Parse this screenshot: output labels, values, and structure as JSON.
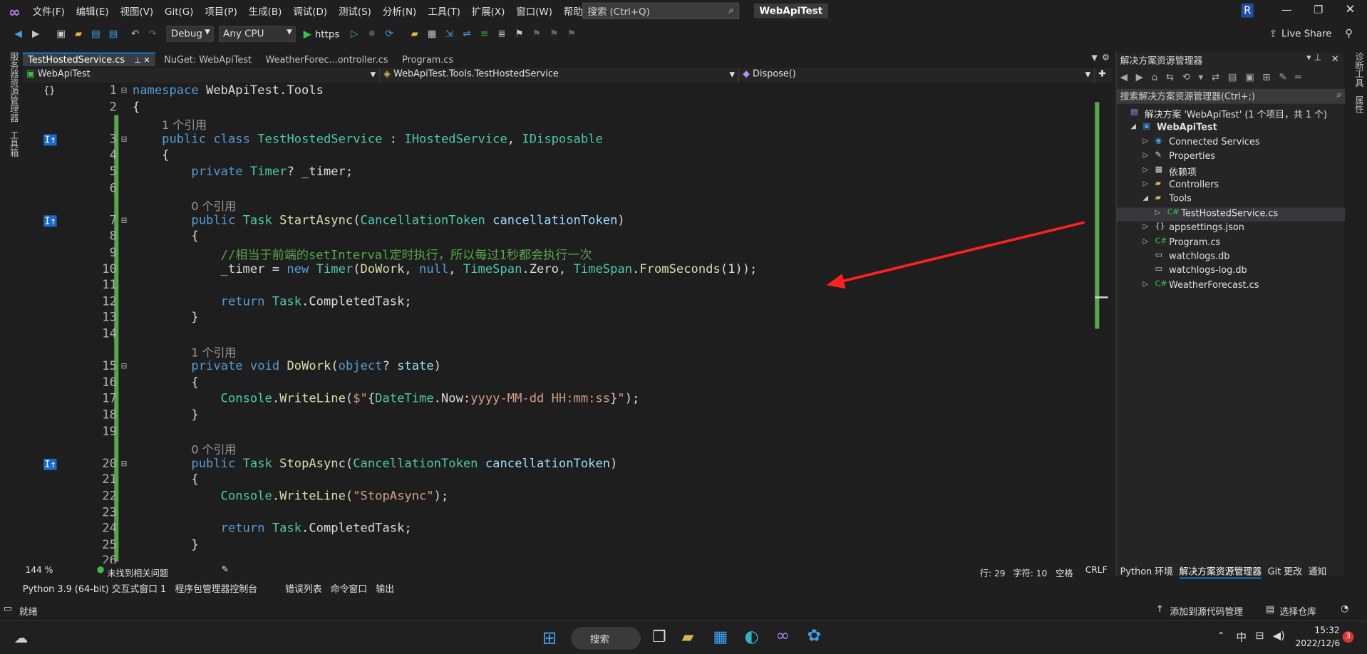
{
  "titlebar": {
    "menus": [
      "文件(F)",
      "编辑(E)",
      "视图(V)",
      "Git(G)",
      "项目(P)",
      "生成(B)",
      "调试(D)",
      "测试(S)",
      "分析(N)",
      "工具(T)",
      "扩展(X)",
      "窗口(W)",
      "帮助(H)"
    ],
    "search_placeholder": "搜索 (Ctrl+Q)",
    "app_title": "WebApiTest",
    "avatar": "R"
  },
  "toolbar": {
    "config": "Debug",
    "platform": "Any CPU",
    "run": "https",
    "live_share": "Live Share"
  },
  "tabs": [
    "TestHostedService.cs",
    "NuGet: WebApiTest",
    "WeatherForec...ontroller.cs",
    "Program.cs"
  ],
  "navbar": {
    "project": "WebApiTest",
    "type": "WebApiTest.Tools.TestHostedService",
    "member": "Dispose()"
  },
  "left_strip": [
    "服务器资源管理器",
    "工具箱"
  ],
  "right_strip": [
    "诊断工具",
    "属性"
  ],
  "code_lines": [
    {
      "n": "1",
      "html": "<span class='kw'>namespace</span> WebApiTest.Tools"
    },
    {
      "n": "2",
      "html": "{"
    },
    {
      "n": "",
      "html": "    <span class='ref'>1 个引用</span>"
    },
    {
      "n": "3",
      "html": "    <span class='kw'>public</span> <span class='kw'>class</span> <span class='ty'>TestHostedService</span> : <span class='ty'>IHostedService</span>, <span class='ty'>IDisposable</span>"
    },
    {
      "n": "4",
      "html": "    {"
    },
    {
      "n": "5",
      "html": "        <span class='kw'>private</span> <span class='ty'>Timer</span>? _timer;"
    },
    {
      "n": "6",
      "html": ""
    },
    {
      "n": "",
      "html": "        <span class='ref'>0 个引用</span>"
    },
    {
      "n": "7",
      "html": "        <span class='kw'>public</span> <span class='ty'>Task</span> <span class='fn'>StartAsync</span>(<span class='ty'>CancellationToken</span> <span class='pm'>cancellationToken</span>)"
    },
    {
      "n": "8",
      "html": "        {"
    },
    {
      "n": "9",
      "html": "            <span class='cm'>//相当于前端的setInterval定时执行，所以每过1秒都会执行一次</span>"
    },
    {
      "n": "10",
      "html": "            _timer = <span class='kw'>new</span> <span class='ty'>Timer</span>(<span class='fn'>DoWork</span>, <span class='kw'>null</span>, <span class='ty'>TimeSpan</span>.Zero, <span class='ty'>TimeSpan</span>.<span class='fn'>FromSeconds</span>(1));"
    },
    {
      "n": "11",
      "html": ""
    },
    {
      "n": "12",
      "html": "            <span class='kw'>return</span> <span class='ty'>Task</span>.CompletedTask;"
    },
    {
      "n": "13",
      "html": "        }"
    },
    {
      "n": "14",
      "html": ""
    },
    {
      "n": "",
      "html": "        <span class='ref'>1 个引用</span>"
    },
    {
      "n": "15",
      "html": "        <span class='kw'>private</span> <span class='kw'>void</span> <span class='fn'>DoWork</span>(<span class='kw'>object</span>? <span class='pm'>state</span>)"
    },
    {
      "n": "16",
      "html": "        {"
    },
    {
      "n": "17",
      "html": "            <span class='ty'>Console</span>.<span class='fn'>WriteLine</span>(<span class='st'>$\"</span>{<span class='ty'>DateTime</span>.Now:<span class='st'>yyyy-MM-dd HH:mm:ss</span>}<span class='st'>\"</span>);"
    },
    {
      "n": "18",
      "html": "        }"
    },
    {
      "n": "19",
      "html": ""
    },
    {
      "n": "",
      "html": "        <span class='ref'>0 个引用</span>"
    },
    {
      "n": "20",
      "html": "        <span class='kw'>public</span> <span class='ty'>Task</span> <span class='fn'>StopAsync</span>(<span class='ty'>CancellationToken</span> <span class='pm'>cancellationToken</span>)"
    },
    {
      "n": "21",
      "html": "        {"
    },
    {
      "n": "22",
      "html": "            <span class='ty'>Console</span>.<span class='fn'>WriteLine</span>(<span class='st'>\"StopAsync\"</span>);"
    },
    {
      "n": "23",
      "html": ""
    },
    {
      "n": "24",
      "html": "            <span class='kw'>return</span> <span class='ty'>Task</span>.CompletedTask;"
    },
    {
      "n": "25",
      "html": "        }"
    },
    {
      "n": "26",
      "html": ""
    }
  ],
  "editor_status": {
    "zoom": "144 %",
    "issues": "未找到相关问题",
    "line": "行: 29",
    "col": "字符: 10",
    "ws": "空格",
    "eol": "CRLF"
  },
  "solution_explorer": {
    "title": "解决方案资源管理器",
    "search": "搜索解决方案资源管理器(Ctrl+;)",
    "items": [
      {
        "label": "解决方案 'WebApiTest' (1 个项目，共 1 个)",
        "icon": "solution-icon",
        "indent": 0
      },
      {
        "label": "WebApiTest",
        "icon": "project-icon",
        "indent": 1,
        "bold": true
      },
      {
        "label": "Connected Services",
        "icon": "connected-icon",
        "indent": 2
      },
      {
        "label": "Properties",
        "icon": "wrench-icon",
        "indent": 2
      },
      {
        "label": "依赖项",
        "icon": "deps-icon",
        "indent": 2
      },
      {
        "label": "Controllers",
        "icon": "folder-icon",
        "indent": 2
      },
      {
        "label": "Tools",
        "icon": "folder-icon",
        "indent": 2
      },
      {
        "label": "TestHostedService.cs",
        "icon": "csharp-icon",
        "indent": 3,
        "selected": true
      },
      {
        "label": "appsettings.json",
        "icon": "json-icon",
        "indent": 2
      },
      {
        "label": "Program.cs",
        "icon": "csharp-icon",
        "indent": 2
      },
      {
        "label": "watchlogs.db",
        "icon": "file-icon",
        "indent": 2
      },
      {
        "label": "watchlogs-log.db",
        "icon": "file-icon",
        "indent": 2
      },
      {
        "label": "WeatherForecast.cs",
        "icon": "csharp-icon",
        "indent": 2
      }
    ],
    "tabs": [
      "Python 环境",
      "解决方案资源管理器",
      "Git 更改",
      "通知"
    ]
  },
  "bottom_tabs": [
    "Python 3.9 (64-bit) 交互式窗口 1",
    "程序包管理器控制台",
    "错误列表",
    "命令窗口",
    "输出"
  ],
  "statusbar": {
    "ready": "就绪",
    "source": "添加到源代码管理",
    "repo": "选择仓库"
  },
  "taskbar": {
    "search": "搜索",
    "ime": "中",
    "time": "15:32",
    "date": "2022/12/6",
    "notif": "3"
  }
}
